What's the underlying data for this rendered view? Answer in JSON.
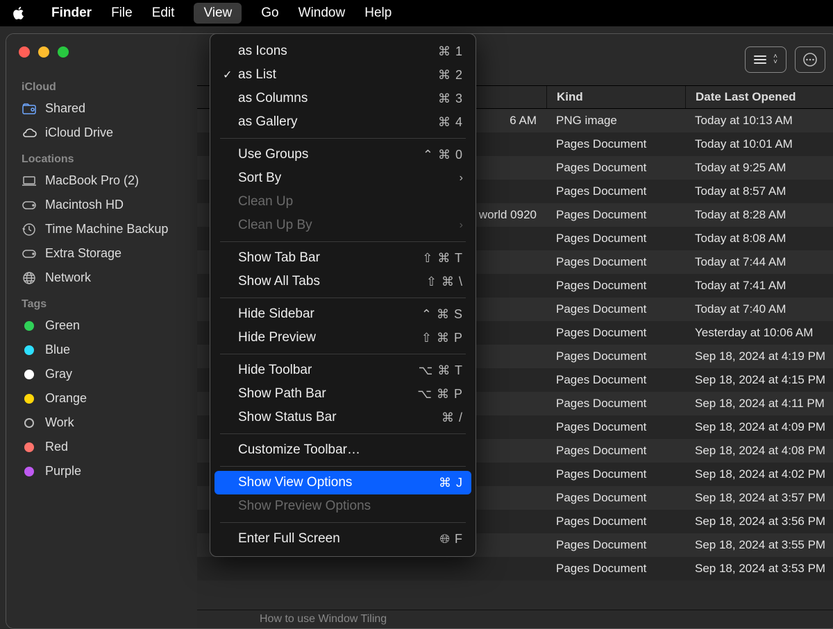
{
  "menubar": {
    "items": [
      "Finder",
      "File",
      "Edit",
      "View",
      "Go",
      "Window",
      "Help"
    ],
    "active_index": 3
  },
  "sidebar": {
    "sections": [
      {
        "label": "iCloud",
        "items": [
          {
            "icon": "shared-folder",
            "label": "Shared"
          },
          {
            "icon": "cloud",
            "label": "iCloud Drive"
          }
        ]
      },
      {
        "label": "Locations",
        "items": [
          {
            "icon": "laptop",
            "label": "MacBook Pro (2)"
          },
          {
            "icon": "hdd",
            "label": "Macintosh HD"
          },
          {
            "icon": "timemachine",
            "label": "Time Machine Backup"
          },
          {
            "icon": "external",
            "label": "Extra Storage"
          },
          {
            "icon": "network",
            "label": "Network"
          }
        ]
      },
      {
        "label": "Tags",
        "items": [
          {
            "color": "#30d158",
            "label": "Green"
          },
          {
            "color": "#2edfff",
            "label": "Blue"
          },
          {
            "color": "#ffffff",
            "label": "Gray"
          },
          {
            "color": "#ffd60a",
            "label": "Orange"
          },
          {
            "color": "outline",
            "label": "Work"
          },
          {
            "color": "#ff736c",
            "label": "Red"
          },
          {
            "color": "#bf5af2",
            "label": "Purple"
          }
        ]
      }
    ]
  },
  "columns": {
    "c0_partial": "6 AM",
    "c1": "Kind",
    "c2": "Date Last Opened"
  },
  "rows": [
    {
      "c0": "6 AM",
      "kind": "PNG image",
      "opened": "Today at 10:13 AM"
    },
    {
      "c0": "",
      "kind": "Pages Document",
      "opened": "Today at 10:01 AM"
    },
    {
      "c0": "",
      "kind": "Pages Document",
      "opened": "Today at 9:25 AM"
    },
    {
      "c0": "",
      "kind": "Pages Document",
      "opened": "Today at 8:57 AM"
    },
    {
      "c0": "world 0920",
      "kind": "Pages Document",
      "opened": "Today at 8:28 AM"
    },
    {
      "c0": "",
      "kind": "Pages Document",
      "opened": "Today at 8:08 AM"
    },
    {
      "c0": "",
      "kind": "Pages Document",
      "opened": "Today at 7:44 AM"
    },
    {
      "c0": "",
      "kind": "Pages Document",
      "opened": "Today at 7:41 AM"
    },
    {
      "c0": "",
      "kind": "Pages Document",
      "opened": "Today at 7:40 AM"
    },
    {
      "c0": "",
      "kind": "Pages Document",
      "opened": "Yesterday at 10:06 AM"
    },
    {
      "c0": "",
      "kind": "Pages Document",
      "opened": "Sep 18, 2024 at 4:19 PM"
    },
    {
      "c0": "",
      "kind": "Pages Document",
      "opened": "Sep 18, 2024 at 4:15 PM"
    },
    {
      "c0": "",
      "kind": "Pages Document",
      "opened": "Sep 18, 2024 at 4:11 PM"
    },
    {
      "c0": "",
      "kind": "Pages Document",
      "opened": "Sep 18, 2024 at 4:09 PM"
    },
    {
      "c0": "",
      "kind": "Pages Document",
      "opened": "Sep 18, 2024 at 4:08 PM"
    },
    {
      "c0": "",
      "kind": "Pages Document",
      "opened": "Sep 18, 2024 at 4:02 PM"
    },
    {
      "c0": "",
      "kind": "Pages Document",
      "opened": "Sep 18, 2024 at 3:57 PM"
    },
    {
      "c0": "",
      "kind": "Pages Document",
      "opened": "Sep 18, 2024 at 3:56 PM"
    },
    {
      "c0": "",
      "kind": "Pages Document",
      "opened": "Sep 18, 2024 at 3:55 PM"
    },
    {
      "c0": "",
      "kind": "Pages Document",
      "opened": "Sep 18, 2024 at 3:53 PM"
    }
  ],
  "footer_partial": "How to use Window Tiling",
  "view_menu": {
    "groups": [
      [
        {
          "label": "as Icons",
          "shortcut": "⌘ 1"
        },
        {
          "label": "as List",
          "shortcut": "⌘ 2",
          "checked": true
        },
        {
          "label": "as Columns",
          "shortcut": "⌘ 3"
        },
        {
          "label": "as Gallery",
          "shortcut": "⌘ 4"
        }
      ],
      [
        {
          "label": "Use Groups",
          "shortcut": "⌃ ⌘ 0"
        },
        {
          "label": "Sort By",
          "submenu": true
        },
        {
          "label": "Clean Up",
          "disabled": true
        },
        {
          "label": "Clean Up By",
          "submenu": true,
          "disabled": true
        }
      ],
      [
        {
          "label": "Show Tab Bar",
          "shortcut": "⇧ ⌘ T"
        },
        {
          "label": "Show All Tabs",
          "shortcut": "⇧ ⌘ \\"
        }
      ],
      [
        {
          "label": "Hide Sidebar",
          "shortcut": "⌃ ⌘ S"
        },
        {
          "label": "Hide Preview",
          "shortcut": "⇧ ⌘ P"
        }
      ],
      [
        {
          "label": "Hide Toolbar",
          "shortcut": "⌥ ⌘ T"
        },
        {
          "label": "Show Path Bar",
          "shortcut": "⌥ ⌘ P"
        },
        {
          "label": "Show Status Bar",
          "shortcut": "⌘ /"
        }
      ],
      [
        {
          "label": "Customize Toolbar…"
        }
      ],
      [
        {
          "label": "Show View Options",
          "shortcut": "⌘ J",
          "highlight": true
        },
        {
          "label": "Show Preview Options",
          "disabled": true
        }
      ],
      [
        {
          "label": "Enter Full Screen",
          "shortcut": "🌐︎ F"
        }
      ]
    ]
  }
}
